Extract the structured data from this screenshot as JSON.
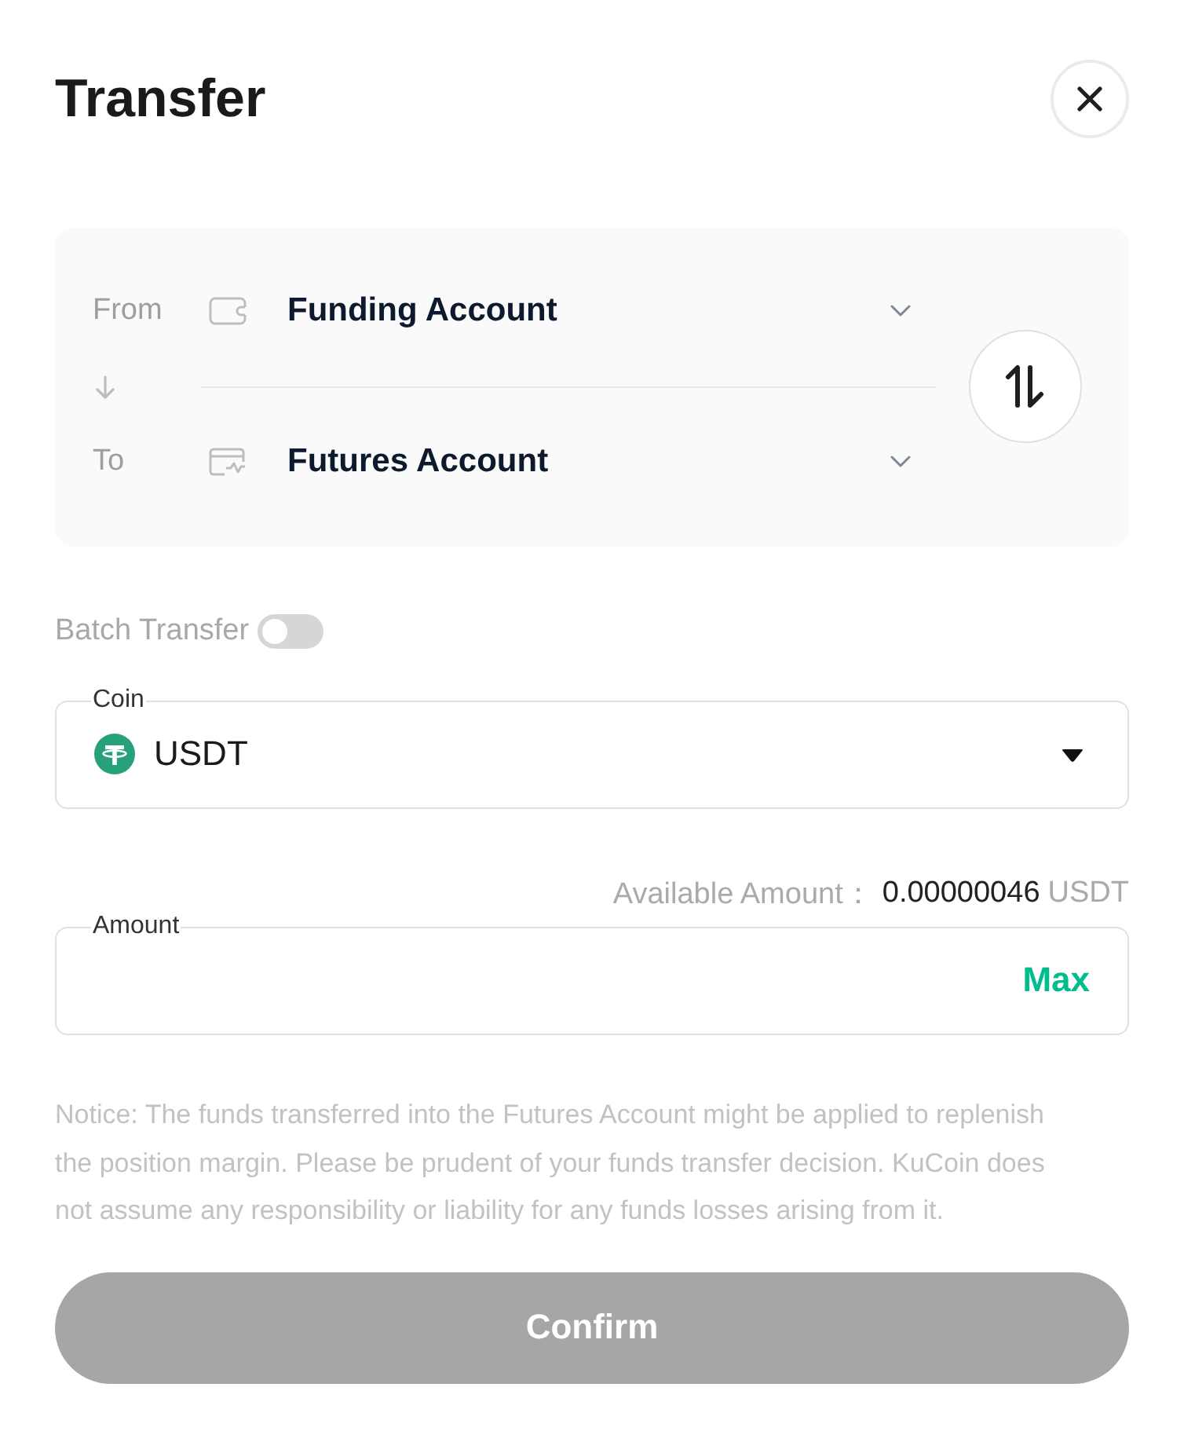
{
  "dialog": {
    "title": "Transfer"
  },
  "accounts": [
    {
      "label": "From",
      "account": "Funding Account",
      "kind": "wallet"
    },
    {
      "label": "To",
      "account": "Futures Account",
      "kind": "futures"
    }
  ],
  "batch_transfer": {
    "label": "Batch Transfer",
    "on": false
  },
  "coin_field": {
    "label": "Coin",
    "value": "USDT"
  },
  "available": {
    "label": "Available Amount：",
    "amount": "0.00000046",
    "unit": "USDT"
  },
  "amount_field": {
    "label": "Amount",
    "max_button": "Max"
  },
  "notice": "Notice: The funds transferred into the Futures Account might be applied to replenish the position margin. Please be prudent of your funds transfer decision. KuCoin does not assume any responsibility or liability for any funds losses arising from it.",
  "confirm_button": {
    "label": "Confirm",
    "disabled": true
  }
}
